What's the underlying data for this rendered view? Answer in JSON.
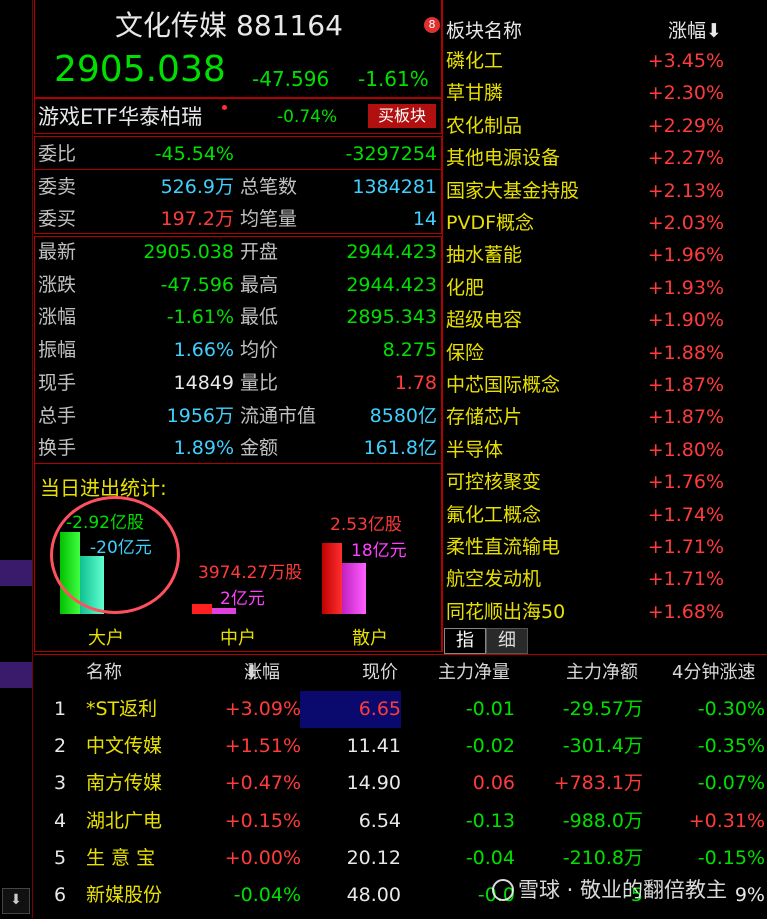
{
  "header": {
    "name": "文化传媒",
    "code": "881164",
    "price": "2905.038",
    "change": "-47.596",
    "change_pct": "-1.61%",
    "badge": "8"
  },
  "etf": {
    "name": "游戏ETF华泰柏瑞",
    "pct": "-0.74%",
    "button": "买板块"
  },
  "order": {
    "weibi_label": "委比",
    "weibi_pct": "-45.54%",
    "weibi_val": "-3297254",
    "weimai_label": "委卖",
    "weimai_val": "526.9万",
    "zongbishu_label": "总笔数",
    "zongbishu_val": "1384281",
    "weimai2_label": "委买",
    "weimai2_val": "197.2万",
    "junbiliang_label": "均笔量",
    "junbiliang_val": "14"
  },
  "quote": {
    "rows": [
      {
        "l1": "最新",
        "v1": "2905.038",
        "l2": "开盘",
        "v2": "2944.423"
      },
      {
        "l1": "涨跌",
        "v1": "-47.596",
        "l2": "最高",
        "v2": "2944.423"
      },
      {
        "l1": "涨幅",
        "v1": "-1.61%",
        "l2": "最低",
        "v2": "2895.343"
      },
      {
        "l1": "振幅",
        "v1": "1.66%",
        "l2": "均价",
        "v2": "8.275"
      },
      {
        "l1": "现手",
        "v1": "14849",
        "l2": "量比",
        "v2": "1.78"
      },
      {
        "l1": "总手",
        "v1": "1956万",
        "l2": "流通市值",
        "v2": "8580亿"
      },
      {
        "l1": "换手",
        "v1": "1.89%",
        "l2": "金额",
        "v2": "161.8亿"
      }
    ]
  },
  "flow": {
    "title": "当日进出统计:",
    "big": {
      "label": "大户",
      "shares": "-2.92亿股",
      "amount": "-20亿元"
    },
    "mid": {
      "label": "中户",
      "shares": "3974.27万股",
      "amount": "2亿元"
    },
    "small": {
      "label": "散户",
      "shares": "2.53亿股",
      "amount": "18亿元"
    }
  },
  "sectors": {
    "header_name": "板块名称",
    "header_pct": "涨幅",
    "items": [
      {
        "name": "磷化工",
        "pct": "+3.45%"
      },
      {
        "name": "草甘膦",
        "pct": "+2.30%"
      },
      {
        "name": "农化制品",
        "pct": "+2.29%"
      },
      {
        "name": "其他电源设备",
        "pct": "+2.27%"
      },
      {
        "name": "国家大基金持股",
        "pct": "+2.13%"
      },
      {
        "name": "PVDF概念",
        "pct": "+2.03%"
      },
      {
        "name": "抽水蓄能",
        "pct": "+1.96%"
      },
      {
        "name": "化肥",
        "pct": "+1.93%"
      },
      {
        "name": "超级电容",
        "pct": "+1.90%"
      },
      {
        "name": "保险",
        "pct": "+1.88%"
      },
      {
        "name": "中芯国际概念",
        "pct": "+1.87%"
      },
      {
        "name": "存储芯片",
        "pct": "+1.87%"
      },
      {
        "name": "半导体",
        "pct": "+1.80%"
      },
      {
        "name": "可控核聚变",
        "pct": "+1.76%"
      },
      {
        "name": "氟化工概念",
        "pct": "+1.74%"
      },
      {
        "name": "柔性直流输电",
        "pct": "+1.71%"
      },
      {
        "name": "航空发动机",
        "pct": "+1.71%"
      },
      {
        "name": "同花顺出海50",
        "pct": "+1.68%"
      }
    ],
    "tab1": "指",
    "tab2": "细"
  },
  "table": {
    "headers": {
      "name": "名称",
      "pct": "涨幅",
      "price": "现价",
      "net": "主力净量",
      "netamt": "主力净额",
      "speed": "4分钟涨速"
    },
    "rows": [
      {
        "idx": "1",
        "name": "*ST返利",
        "pct": "+3.09%",
        "price": "6.65",
        "net": "-0.01",
        "netamt": "-29.57万",
        "speed": "-0.30%"
      },
      {
        "idx": "2",
        "name": "中文传媒",
        "pct": "+1.51%",
        "price": "11.41",
        "net": "-0.02",
        "netamt": "-301.4万",
        "speed": "-0.35%"
      },
      {
        "idx": "3",
        "name": "南方传媒",
        "pct": "+0.47%",
        "price": "14.90",
        "net": "0.06",
        "netamt": "+783.1万",
        "speed": "-0.07%"
      },
      {
        "idx": "4",
        "name": "湖北广电",
        "pct": "+0.15%",
        "price": "6.54",
        "net": "-0.13",
        "netamt": "-988.0万",
        "speed": "+0.31%"
      },
      {
        "idx": "5",
        "name": "生 意 宝",
        "pct": "+0.00%",
        "price": "20.12",
        "net": "-0.04",
        "netamt": "-210.8万",
        "speed": "-0.15%"
      },
      {
        "idx": "6",
        "name": "新媒股份",
        "pct": "-0.04%",
        "price": "48.00",
        "net": "-0.0",
        "netamt": "-5",
        "speed": "9%"
      }
    ]
  },
  "watermark": "雪球 · 敬业的翻倍教主",
  "colors": {
    "up": "#ff3b3b",
    "down": "#00e000",
    "border": "#b00000",
    "accent": "#e8e000"
  }
}
